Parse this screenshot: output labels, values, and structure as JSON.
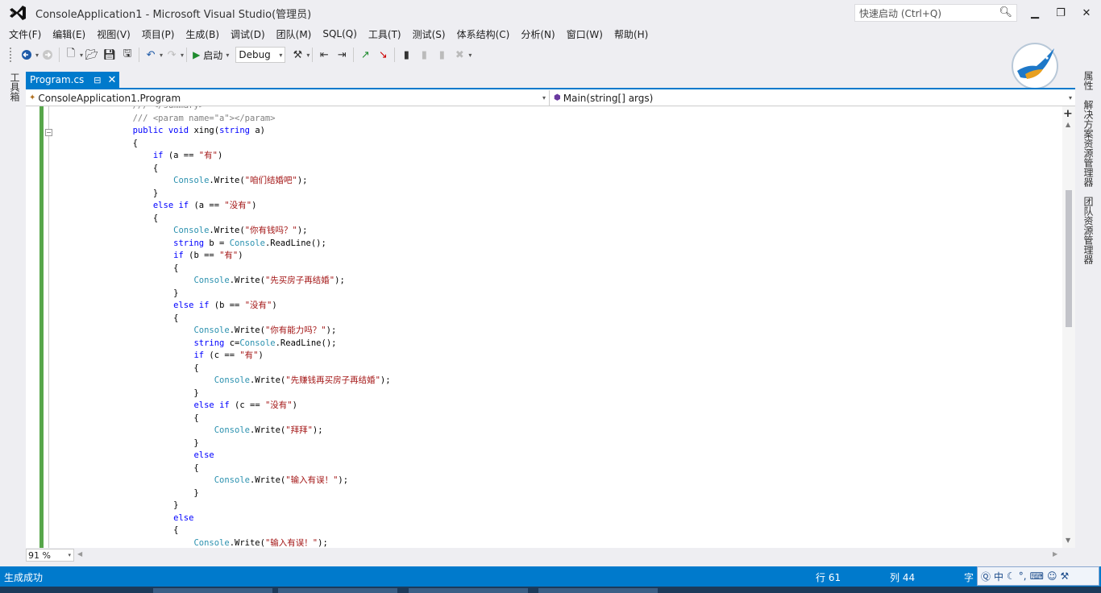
{
  "window": {
    "title": "ConsoleApplication1 - Microsoft Visual Studio(管理员)",
    "quick_launch_placeholder": "快速启动 (Ctrl+Q)"
  },
  "menu": [
    "文件(F)",
    "编辑(E)",
    "视图(V)",
    "项目(P)",
    "生成(B)",
    "调试(D)",
    "团队(M)",
    "SQL(Q)",
    "工具(T)",
    "测试(S)",
    "体系结构(C)",
    "分析(N)",
    "窗口(W)",
    "帮助(H)"
  ],
  "toolbar": {
    "start_label": "启动",
    "config_value": "Debug"
  },
  "left_strip": {
    "toolbox_label": "工具箱"
  },
  "right_strip": {
    "properties_label": "属性",
    "solution_explorer_label": "解决方案资源管理器",
    "team_explorer_label": "团队资源管理器"
  },
  "tab": {
    "label": "Program.cs"
  },
  "navbar": {
    "type_value": "ConsoleApplication1.Program",
    "member_value": "Main(string[] args)"
  },
  "code_lines": [
    "        /// </summary>",
    "        /// <param name=\"a\"></param>",
    "        public void xing(string a)",
    "        {",
    "            if (a == \"有\")",
    "            {",
    "                Console.Write(\"咱们结婚吧\");",
    "            }",
    "            else if (a == \"没有\")",
    "            {",
    "                Console.Write(\"你有钱吗？\");",
    "                string b = Console.ReadLine();",
    "                if (b == \"有\")",
    "                {",
    "                    Console.Write(\"先买房子再结婚\");",
    "                }",
    "                else if (b == \"没有\")",
    "                {",
    "                    Console.Write(\"你有能力吗？\");",
    "                    string c=Console.ReadLine();",
    "                    if (c == \"有\")",
    "                    {",
    "                        Console.Write(\"先赚钱再买房子再结婚\");",
    "                    }",
    "                    else if (c == \"没有\")",
    "                    {",
    "                        Console.Write(\"拜拜\");",
    "                    }",
    "                    else",
    "                    {",
    "                        Console.Write(\"输入有误！\");",
    "                    }",
    "                }",
    "                else",
    "                {",
    "                    Console.Write(\"输入有误！\");"
  ],
  "zoom": {
    "value": "91 %"
  },
  "status": {
    "message": "生成成功",
    "row": "行 61",
    "col": "列 44",
    "char": "字"
  },
  "ime": {
    "lang": "中"
  }
}
